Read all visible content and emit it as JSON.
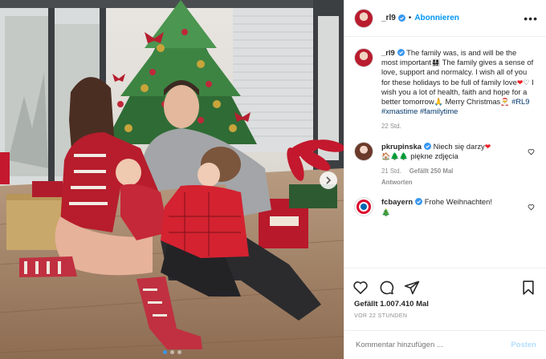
{
  "header": {
    "username": "_rl9",
    "bullet": "•",
    "follow_label": "Abonnieren",
    "more_label": "•••"
  },
  "caption": {
    "username": "_rl9",
    "text_1": " The family was, is and will be the most important",
    "text_2": " The family gives a sense of love, support and normalcy. I wish all of you for these holidays to be full of family love",
    "text_3": " I wish you a lot of health, faith and hope for a better tomorrow",
    "text_4": " Merry Christmas",
    "hashtag_1": "#RL9",
    "hashtag_2": "#xmastime",
    "hashtag_3": "#familytime",
    "time": "22 Std.",
    "emoji_family": "👨‍👩‍👧‍👧",
    "emoji_heart_red": "❤",
    "emoji_heart_white": "♡",
    "emoji_pray": "🙏",
    "emoji_santa": "🎅"
  },
  "comments": [
    {
      "username": "pkrupinska",
      "text": " Niech się darzy",
      "emoji_heart": "❤",
      "emoji_house": "🏠",
      "emoji_trees": "🌲🌲",
      "text2": " piękne zdjęcia",
      "time": "21 Std.",
      "likes": "Gefällt 250 Mal",
      "reply": "Antworten"
    },
    {
      "username": "fcbayern",
      "text": " Frohe Weihnachten!",
      "emoji_tree": "🎄"
    }
  ],
  "stats": {
    "likes": "Gefällt 1.007.410 Mal",
    "time": "VOR 22 STUNDEN"
  },
  "composer": {
    "placeholder": "Kommentar hinzufügen ...",
    "post_label": "Posten"
  },
  "icons": [
    "heart-icon",
    "comment-icon",
    "share-icon",
    "bookmark-icon",
    "verified-icon",
    "chevron-right-icon"
  ],
  "colors": {
    "accent": "#0095f6",
    "verified": "#3897f0",
    "text": "#262626",
    "muted": "#8e8e8e"
  },
  "carousel": {
    "slides": 3,
    "active": 1
  }
}
